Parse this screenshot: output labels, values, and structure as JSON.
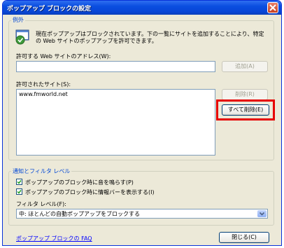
{
  "window": {
    "title": "ポップアップ ブロックの設定",
    "close_icon": "close-icon"
  },
  "exceptions": {
    "legend": "例外",
    "info_icon": "popup-shield-icon",
    "info_line1": "現在ポップアップはブロックされています。下の一覧にサイトを追加することにより、特定",
    "info_line2": "の Web サイトのポップアップを許可できます。",
    "address_label": "許可する Web サイトのアドレス(W):",
    "address_value": "",
    "add_button": "追加(A)",
    "allowed_label": "許可されたサイト(S):",
    "allowed_sites": [
      "www.fmworld.net"
    ],
    "remove_button": "削除(R)",
    "remove_all_button": "すべて削除(E)"
  },
  "notification": {
    "legend": "通知とフィルタ レベル",
    "checkbox1_label": "ポップアップのブロック時に音を鳴らす(P)",
    "checkbox1_checked": true,
    "checkbox2_label": "ポップアップのブロック時に情報バーを表示する(I)",
    "checkbox2_checked": true,
    "filter_label": "フィルタ レベル(F):",
    "filter_value": "中: ほとんどの自動ポップアップをブロックする"
  },
  "footer": {
    "faq_link": "ポップアップ ブロックの FAQ",
    "close_button": "閉じる(C)"
  },
  "colors": {
    "titlebar": "#0845d6",
    "legend_text": "#0046d5",
    "highlight": "#e60000"
  }
}
